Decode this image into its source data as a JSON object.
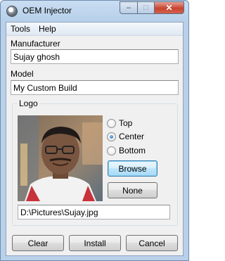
{
  "window": {
    "title": "OEM Injector",
    "controls": {
      "minimize": "–",
      "maximize": "□",
      "close": "✕"
    }
  },
  "menu": {
    "items": [
      "Tools",
      "Help"
    ]
  },
  "manufacturer": {
    "label": "Manufacturer",
    "value": "Sujay ghosh"
  },
  "model": {
    "label": "Model",
    "value": "My Custom Build"
  },
  "logo": {
    "group_label": "Logo",
    "position_options": [
      "Top",
      "Center",
      "Bottom"
    ],
    "selected_position": "Center",
    "browse_label": "Browse",
    "none_label": "None",
    "path": "D:\\Pictures\\Sujay.jpg"
  },
  "actions": {
    "clear": "Clear",
    "install": "Install",
    "cancel": "Cancel"
  }
}
